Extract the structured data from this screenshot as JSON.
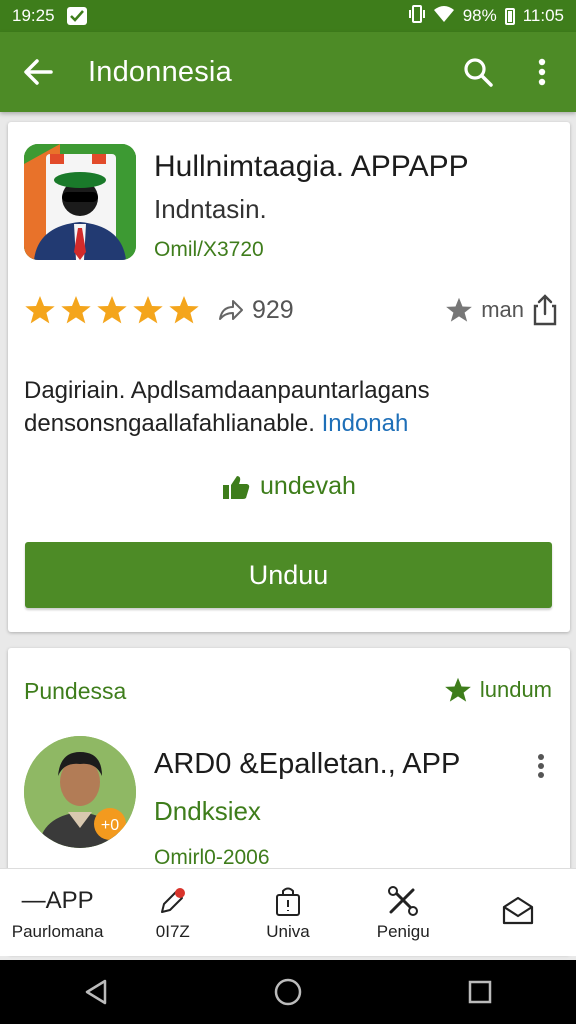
{
  "status_bar": {
    "time_left": "19:25",
    "battery_percent": "98%",
    "time_right": "11:05"
  },
  "app_bar": {
    "title": "Indonnesia"
  },
  "app_card": {
    "name": "Hullnimtaagia. APPAPP",
    "subtitle": "Indntasin.",
    "code": "Omil/X3720",
    "rating_stars": 5,
    "share_count": "929",
    "wishlist_label": "man",
    "description_line1": "Dagiriain. Apdlsamdaanpauntarlagans",
    "description_line2": "densonsngaallafahlianable.",
    "description_link": "Indonah",
    "like_label": "undevah",
    "install_button": "Unduu"
  },
  "developer_card": {
    "section_title": "Pundessa",
    "section_action": "lundum",
    "dev_name": "ARD0 &Epalletan., APP",
    "dev_subtitle": "Dndksiex",
    "dev_code": "Omirl0-2006"
  },
  "bottom_nav": {
    "items": [
      {
        "icon_text": "—APP",
        "label": "Paurlomana"
      },
      {
        "icon": "edit-icon",
        "label": "0I7Z"
      },
      {
        "icon": "bag-icon",
        "label": "Univa"
      },
      {
        "icon": "tools-icon",
        "label": "Penigu"
      },
      {
        "icon": "mail-icon",
        "label": ""
      }
    ]
  },
  "colors": {
    "status_bar": "#3e7d1b",
    "app_bar": "#4d8b26",
    "star": "#f4a51c",
    "accent_green": "#3e7d1b",
    "link_blue": "#1e6fb8"
  }
}
